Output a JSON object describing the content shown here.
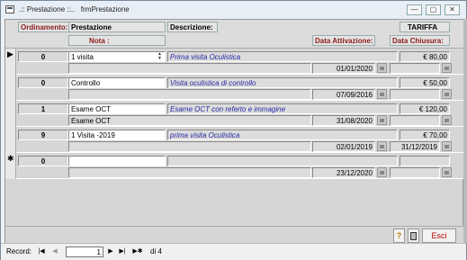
{
  "window": {
    "title": ".:: Prestazione ::..   frmPrestazione",
    "min_label": "—",
    "max_label": "▢",
    "close_label": "✕"
  },
  "header": {
    "ordinamento": "Ordinamento:",
    "prestazione": "Prestazione",
    "descrizione": "Descrizione:",
    "tariffa": "TARIFFA",
    "nota": "Nota :",
    "data_attivazione": "Data Attivazione:",
    "data_chiusura": "Data Chiusura:"
  },
  "records": [
    {
      "marker": "▶",
      "ord": "0",
      "prestazione": "1 visita",
      "descrizione": "Prima visita Oculistica",
      "tariffa": "€ 80,00",
      "nota": "",
      "data_attivazione": "01/01/2020",
      "data_chiusura": ""
    },
    {
      "marker": "",
      "ord": "0",
      "prestazione": "Controllo",
      "descrizione": "Visita oculistica di controllo",
      "tariffa": "€ 50,00",
      "nota": "",
      "data_attivazione": "07/09/2016",
      "data_chiusura": ""
    },
    {
      "marker": "",
      "ord": "1",
      "prestazione": "Esame OCT",
      "descrizione": "Esame OCT con referto  e immagine",
      "tariffa": "€ 120,00",
      "nota": "Esame OCT",
      "data_attivazione": "31/08/2020",
      "data_chiusura": ""
    },
    {
      "marker": "",
      "ord": "9",
      "prestazione": "1 Visita -2019",
      "descrizione": "prima visita Oculistica",
      "tariffa": "€ 70,00",
      "nota": "",
      "data_attivazione": "02/01/2019",
      "data_chiusura": "31/12/2019"
    },
    {
      "marker": "✱",
      "ord": "0",
      "prestazione": "",
      "descrizione": "",
      "tariffa": "",
      "nota": "",
      "data_attivazione": "23/12/2020",
      "data_chiusura": ""
    }
  ],
  "footer": {
    "help_icon": "?",
    "delete_icon": "trash",
    "esci_label": "Esci"
  },
  "navigation": {
    "record_label": "Record:",
    "first": "|◀",
    "prev": "◀",
    "current": "1",
    "next": "▶",
    "last": "▶|",
    "new": "▶✱",
    "total": "di 4"
  }
}
